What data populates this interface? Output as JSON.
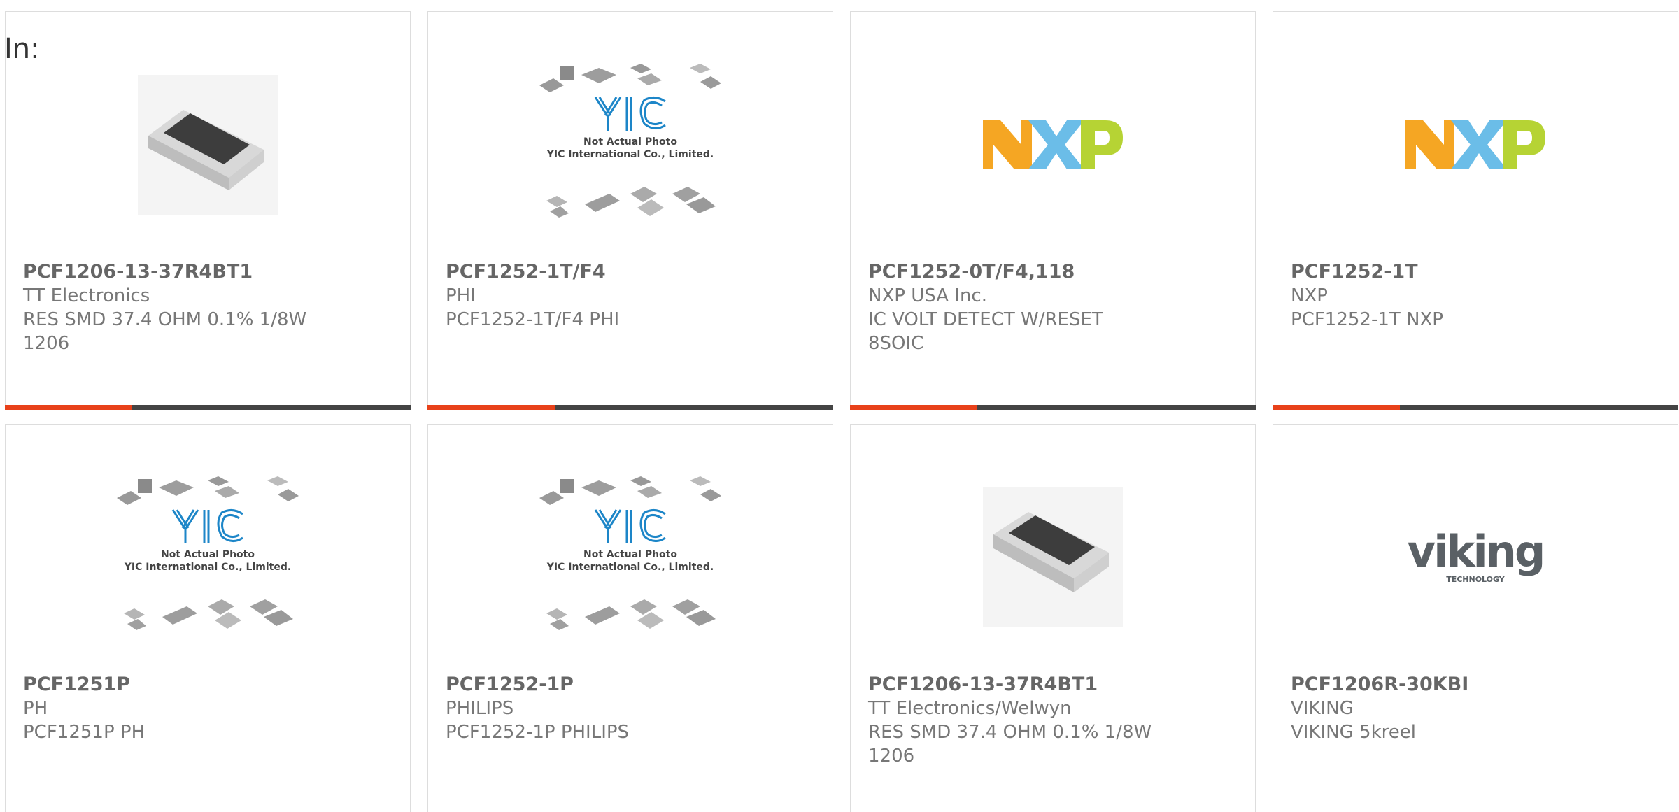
{
  "page": {
    "in_label": "In:"
  },
  "colors": {
    "accent_orange": "#e8411a",
    "accent_dark": "#444444",
    "nxp_orange": "#f5a623",
    "nxp_blue": "#6bbde8",
    "nxp_green": "#b6d334",
    "yic_blue": "#1d86c8",
    "viking_gray": "#5a6065"
  },
  "products": [
    {
      "part": "PCF1206-13-37R4BT1",
      "maker": "TT Electronics",
      "desc1": "RES SMD 37.4 OHM 0.1% 1/8W",
      "desc2": "1206",
      "image": "resistor-chip"
    },
    {
      "part": "PCF1252-1T/F4",
      "maker": "PHI",
      "desc1": "PCF1252-1T/F4 PHI",
      "desc2": "",
      "image": "yic-placeholder"
    },
    {
      "part": "PCF1252-0T/F4,118",
      "maker": "NXP USA Inc.",
      "desc1": "IC VOLT DETECT W/RESET",
      "desc2": "8SOIC",
      "image": "nxp-logo"
    },
    {
      "part": "PCF1252-1T",
      "maker": "NXP",
      "desc1": "PCF1252-1T NXP",
      "desc2": "",
      "image": "nxp-logo"
    },
    {
      "part": "PCF1251P",
      "maker": "PH",
      "desc1": "PCF1251P PH",
      "desc2": "",
      "image": "yic-placeholder"
    },
    {
      "part": "PCF1252-1P",
      "maker": "PHILIPS",
      "desc1": "PCF1252-1P PHILIPS",
      "desc2": "",
      "image": "yic-placeholder"
    },
    {
      "part": "PCF1206-13-37R4BT1",
      "maker": "TT Electronics/Welwyn",
      "desc1": "RES SMD 37.4 OHM 0.1% 1/8W",
      "desc2": "1206",
      "image": "resistor-chip"
    },
    {
      "part": "PCF1206R-30KBI",
      "maker": "VIKING",
      "desc1": "VIKING 5kreel",
      "desc2": "",
      "image": "viking-logo"
    }
  ],
  "yic": {
    "line1": "Not Actual Photo",
    "line2": "YIC International Co., Limited.",
    "logo": "YIC"
  },
  "nxp": {
    "letters": [
      "N",
      "X",
      "P"
    ]
  },
  "viking": {
    "name": "viking",
    "tagline": "TECHNOLOGY"
  }
}
